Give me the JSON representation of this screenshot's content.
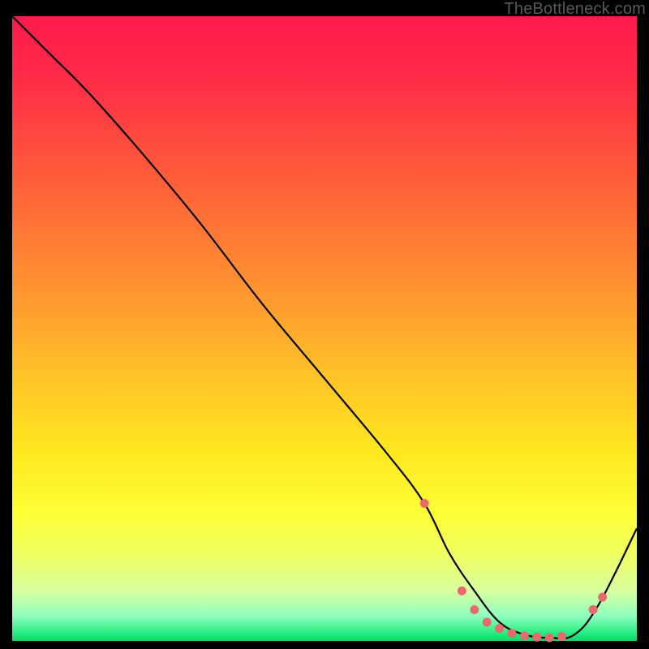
{
  "watermark": "TheBottleneck.com",
  "chart_data": {
    "type": "line",
    "title": "",
    "xlabel": "",
    "ylabel": "",
    "xlim": [
      0,
      100
    ],
    "ylim": [
      0,
      100
    ],
    "curve": {
      "x": [
        0,
        6,
        12,
        20,
        30,
        40,
        50,
        60,
        66,
        70,
        74,
        78,
        82,
        86,
        90,
        94,
        100
      ],
      "y": [
        100,
        94,
        88,
        79,
        67,
        54,
        42,
        30,
        22,
        14,
        8,
        3,
        1,
        0.5,
        1,
        6,
        18
      ]
    },
    "dots": {
      "x": [
        66,
        72,
        74,
        76,
        78,
        80,
        82,
        84,
        86,
        88,
        93,
        94.5
      ],
      "y": [
        22,
        8,
        5,
        3,
        2,
        1.2,
        0.8,
        0.6,
        0.5,
        0.7,
        5,
        7
      ]
    },
    "colors": {
      "curve": "#000000",
      "dots": "#e86a6a"
    }
  }
}
